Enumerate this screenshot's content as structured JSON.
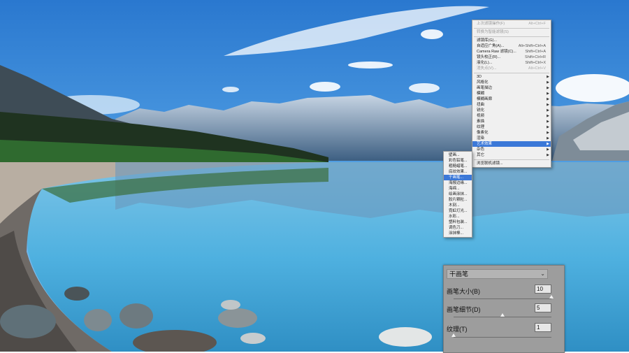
{
  "filter_menu": {
    "items": [
      {
        "label": "上次滤镜操作(F)",
        "shortcut": "Alt+Ctrl+F",
        "disabled": true
      },
      {
        "sep": true
      },
      {
        "label": "转换为智能滤镜(S)",
        "shortcut": "",
        "disabled": true
      },
      {
        "sep": true
      },
      {
        "label": "滤镜库(G)...",
        "shortcut": ""
      },
      {
        "label": "自适应广角(A)...",
        "shortcut": "Alt+Shift+Ctrl+A"
      },
      {
        "label": "Camera Raw 滤镜(C)...",
        "shortcut": "Shift+Ctrl+A"
      },
      {
        "label": "镜头校正(R)...",
        "shortcut": "Shift+Ctrl+R"
      },
      {
        "label": "液化(L)...",
        "shortcut": "Shift+Ctrl+X"
      },
      {
        "label": "消失点(V)...",
        "shortcut": "Alt+Ctrl+V",
        "disabled": true
      },
      {
        "sep": true
      },
      {
        "label": "3D",
        "submenu": true
      },
      {
        "label": "风格化",
        "submenu": true
      },
      {
        "label": "画笔描边",
        "submenu": true
      },
      {
        "label": "模糊",
        "submenu": true
      },
      {
        "label": "模糊画廊",
        "submenu": true
      },
      {
        "label": "扭曲",
        "submenu": true
      },
      {
        "label": "锐化",
        "submenu": true
      },
      {
        "label": "视频",
        "submenu": true
      },
      {
        "label": "素描",
        "submenu": true
      },
      {
        "label": "纹理",
        "submenu": true
      },
      {
        "label": "像素化",
        "submenu": true
      },
      {
        "label": "渲染",
        "submenu": true
      },
      {
        "label": "艺术效果",
        "submenu": true,
        "highlighted": true
      },
      {
        "label": "杂色",
        "submenu": true
      },
      {
        "label": "其它",
        "submenu": true
      },
      {
        "sep": true
      },
      {
        "label": "浏览联机滤镜..."
      }
    ]
  },
  "art_menu": {
    "items": [
      {
        "label": "壁画..."
      },
      {
        "label": "彩色铅笔..."
      },
      {
        "label": "粗糙蜡笔..."
      },
      {
        "label": "底纹效果..."
      },
      {
        "label": "干画笔...",
        "highlighted": true
      },
      {
        "label": "海报边缘..."
      },
      {
        "label": "海绵..."
      },
      {
        "label": "绘画涂抹..."
      },
      {
        "label": "胶片颗粒..."
      },
      {
        "label": "木刻..."
      },
      {
        "label": "霓虹灯光..."
      },
      {
        "label": "水彩..."
      },
      {
        "label": "塑料包装..."
      },
      {
        "label": "调色刀..."
      },
      {
        "label": "涂抹棒..."
      }
    ]
  },
  "panel": {
    "filter_name": "干画笔",
    "fields": [
      {
        "label": "画笔大小(B)",
        "value": "10",
        "fraction": 1.0
      },
      {
        "label": "画笔细节(D)",
        "value": "5",
        "fraction": 0.5
      },
      {
        "label": "纹理(T)",
        "value": "1",
        "fraction": 0.0
      }
    ]
  },
  "colors": {
    "menu_highlight": "#3b78d8",
    "panel_bg": "#9d9d9d",
    "sky_top": "#2d7fd4",
    "lake": "#5fb6df"
  }
}
